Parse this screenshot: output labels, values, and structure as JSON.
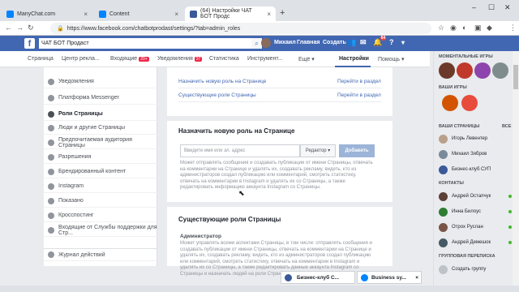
{
  "browser": {
    "tabs": [
      {
        "title": "ManyChat.com",
        "color": "#0084ff"
      },
      {
        "title": "Content",
        "color": "#0084ff"
      },
      {
        "title": "(64) Настройки ЧАТ БОТ Продс",
        "color": "#3b5998"
      }
    ],
    "url": "https://www.facebook.com/chatbotprodast/settings/?tab=admin_roles"
  },
  "fb": {
    "logo": "f",
    "page_title": "ЧАТ БОТ Продаст",
    "user": "Михаил",
    "home": "Главная",
    "create": "Создать",
    "notif_count": "64"
  },
  "page_tabs": [
    {
      "label": "Страница"
    },
    {
      "label": "Центр рекла..."
    },
    {
      "label": "Входящие",
      "badge": "20+"
    },
    {
      "label": "Уведомления",
      "badge": "37"
    },
    {
      "label": "Статистика"
    },
    {
      "label": "Инструмент..."
    },
    {
      "label": "Ещё ▾"
    },
    {
      "label": "Настройки"
    },
    {
      "label": "Помощь ▾"
    }
  ],
  "sidebar": {
    "items": [
      {
        "label": "Уведомления",
        "icon": "globe-icon"
      },
      {
        "label": "Платформа Messenger",
        "icon": "messenger-icon"
      },
      {
        "label": "Роли Страницы",
        "icon": "user-icon"
      },
      {
        "label": "Люди и другие Страницы",
        "icon": "people-icon"
      },
      {
        "label": "Предпочитаемая аудитория Страницы",
        "icon": "people-icon"
      },
      {
        "label": "Разрешения",
        "icon": "flag-icon"
      },
      {
        "label": "Брендированный контент",
        "icon": "handshake-icon"
      },
      {
        "label": "Instagram",
        "icon": "instagram-icon"
      },
      {
        "label": "Показано",
        "icon": "star-icon"
      },
      {
        "label": "Кросспостинг",
        "icon": "video-icon"
      },
      {
        "label": "Входящие от Службы поддержки для Стр...",
        "icon": "inbox-icon"
      },
      {
        "label": "Журнал действий",
        "icon": "list-icon"
      }
    ]
  },
  "summary": {
    "rows": [
      {
        "left": "Назначить новую роль на Странице",
        "right": "Перейти в раздел"
      },
      {
        "left": "Существующие роли Страницы",
        "right": "Перейти в раздел"
      }
    ]
  },
  "assign": {
    "heading": "Назначить новую роль на Странице",
    "placeholder": "Введите имя или эл. адрес",
    "role": "Редактор ▾",
    "add": "Добавить",
    "desc": "Может отправлять сообщения и создавать публикации от имени Страницы, отвечать на комментарии на Странице и удалять их, создавать рекламу, видеть, кто из администраторов создал публикацию или комментарий, смотреть статистику, отвечать на комментарии в Instagram и удалять их со Страницы, а также редактировать информацию аккаунта Instagram со Страницы."
  },
  "existing": {
    "heading": "Существующие роли Страницы",
    "admin_label": "Администратор",
    "admin_desc": "Может управлять всеми аспектами Страницы, в том числе: отправлять сообщения и создавать публикации от имени Страницы, отвечать на комментарии на Странице и удалять их, создавать рекламу, видеть, кто из администраторов создал публикацию или комментарий, смотреть статистику, отвечать на комментарии в Instagram и удалять их со Страницы, а также редактировать данные аккаунта Instagram со Страницы и назначать людей на роли Страницы."
  },
  "right": {
    "games_heading": "МОМЕНТАЛЬНЫЕ ИГРЫ",
    "my_games": "ВАШИ ИГРЫ",
    "pages_heading": "ВАШИ СТРАНИЦЫ",
    "pages_all": "ВСЕ",
    "pages": [
      "Игорь Левентер",
      "Михаил Зябров",
      "Бизнес-клуб СУП"
    ],
    "contacts_heading": "КОНТАКТЫ",
    "contacts": [
      "Андрей Остапчук",
      "Инна Билоус",
      "Отрох Руслан",
      "Андрей Демешок"
    ],
    "group_heading": "ГРУППОВАЯ ПЕРЕПИСКА",
    "create_group": "Создать группу"
  },
  "chats": {
    "chat1": "Бизнес-клуб С...",
    "chat2": "Business sy..."
  }
}
